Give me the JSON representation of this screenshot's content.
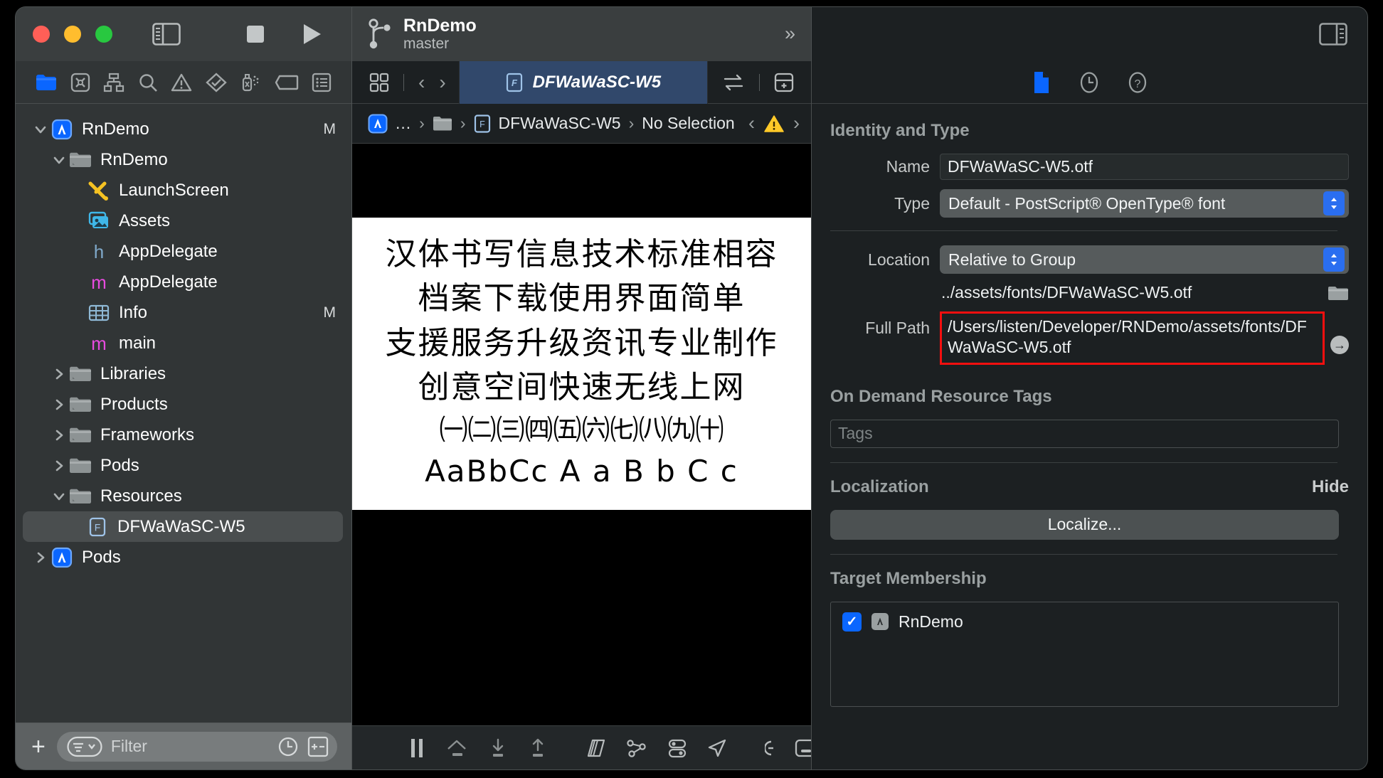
{
  "window": {
    "traffic_lights": [
      "close",
      "minimize",
      "zoom"
    ]
  },
  "toolbar": {
    "sidebar_toggle": "sidebar-toggle-icon",
    "stop_label": "stop-button",
    "run_label": "run-button",
    "scheme_title": "RnDemo",
    "scheme_branch": "master",
    "expand_chevrons": "»",
    "inspector_toggle": "inspector-toggle-icon"
  },
  "navigator": {
    "tabs": [
      "project-navigator-icon",
      "source-control-navigator-icon",
      "hierarchy-navigator-icon",
      "find-navigator-icon",
      "issue-navigator-icon",
      "test-navigator-icon",
      "debug-navigator-icon",
      "breakpoint-navigator-icon",
      "report-navigator-icon"
    ],
    "tree": [
      {
        "label": "RnDemo",
        "icon": "app-project-icon",
        "indent": 0,
        "disclosure": "open",
        "status": "M",
        "selected": false
      },
      {
        "label": "RnDemo",
        "icon": "folder-icon",
        "indent": 1,
        "disclosure": "open",
        "status": "",
        "selected": false
      },
      {
        "label": "LaunchScreen",
        "icon": "storyboard-icon",
        "indent": 2,
        "disclosure": "none",
        "status": "",
        "selected": false
      },
      {
        "label": "Assets",
        "icon": "assets-icon",
        "indent": 2,
        "disclosure": "none",
        "status": "",
        "selected": false
      },
      {
        "label": "AppDelegate",
        "icon": "header-h-icon",
        "indent": 2,
        "disclosure": "none",
        "status": "",
        "selected": false
      },
      {
        "label": "AppDelegate",
        "icon": "objc-m-icon",
        "indent": 2,
        "disclosure": "none",
        "status": "",
        "selected": false
      },
      {
        "label": "Info",
        "icon": "plist-icon",
        "indent": 2,
        "disclosure": "none",
        "status": "M",
        "selected": false
      },
      {
        "label": "main",
        "icon": "objc-m-icon",
        "indent": 2,
        "disclosure": "none",
        "status": "",
        "selected": false
      },
      {
        "label": "Libraries",
        "icon": "folder-icon",
        "indent": 1,
        "disclosure": "closed",
        "status": "",
        "selected": false
      },
      {
        "label": "Products",
        "icon": "folder-icon",
        "indent": 1,
        "disclosure": "closed",
        "status": "",
        "selected": false
      },
      {
        "label": "Frameworks",
        "icon": "folder-icon",
        "indent": 1,
        "disclosure": "closed",
        "status": "",
        "selected": false
      },
      {
        "label": "Pods",
        "icon": "folder-plain-icon",
        "indent": 1,
        "disclosure": "closed",
        "status": "",
        "selected": false
      },
      {
        "label": "Resources",
        "icon": "folder-icon",
        "indent": 1,
        "disclosure": "open",
        "status": "",
        "selected": false
      },
      {
        "label": "DFWaWaSC-W5",
        "icon": "font-file-icon",
        "indent": 2,
        "disclosure": "none",
        "status": "",
        "selected": true
      },
      {
        "label": "Pods",
        "icon": "app-project-icon",
        "indent": 0,
        "disclosure": "closed",
        "status": "",
        "selected": false
      }
    ],
    "filter": {
      "placeholder": "Filter",
      "scope_icon": "filter-scope-icon",
      "recent_icon": "clock-icon",
      "source_control_icon": "sc-filter-icon",
      "add_icon": "+"
    }
  },
  "editor": {
    "jump_bar": {
      "related_items_icon": "related-items-icon",
      "back_icon": "‹",
      "forward_icon": "›",
      "tab_label": "DFWaWaSC-W5",
      "tab_file_icon": "font-file-icon",
      "assistant_icon": "assistant-editor-icon",
      "add_editor_icon": "add-editor-icon"
    },
    "breadcrumb": {
      "project_icon": "app-project-icon",
      "items": [
        "...",
        "folder-icon",
        "DFWaWaSC-W5",
        "No Selection"
      ],
      "file_icon": "font-file-icon",
      "prev_issue_icon": "‹",
      "warning_icon": "warning-icon",
      "next_issue_icon": "›"
    },
    "font_preview": {
      "lines": [
        "汉体书写信息技术标准相容",
        "档案下载使用界面简单",
        "支援服务升级资讯专业制作",
        "创意空间快速无线上网",
        "㈠㈡㈢㈣㈤㈥㈦㈧㈨㈩",
        "AaBbCc A a B b C c"
      ]
    },
    "debug_bar": {
      "icons": [
        "hide-debug-area-icon",
        "pause-icon",
        "step-over-icon",
        "step-into-icon",
        "step-out-icon",
        "view-hierarchy-icon",
        "memory-graph-icon",
        "environment-overrides-icon",
        "simulate-location-icon",
        "console-filter-icon",
        "console-toggle-icon"
      ]
    }
  },
  "inspector": {
    "tabs": [
      "file-inspector-icon",
      "history-inspector-icon",
      "quick-help-icon"
    ],
    "identity": {
      "section_title": "Identity and Type",
      "name_label": "Name",
      "name_value": "DFWaWaSC-W5.otf",
      "type_label": "Type",
      "type_value": "Default - PostScript® OpenType® font",
      "location_label": "Location",
      "location_value": "Relative to Group",
      "relative_path": "../assets/fonts/DFWaWaSC-W5.otf",
      "choose_folder_icon": "folder-icon",
      "full_path_label": "Full Path",
      "full_path_value": "/Users/listen/Developer/RNDemo/assets/fonts/DFWaWaSC-W5.otf",
      "reveal_icon": "→",
      "highlight_color": "#f40f0f"
    },
    "on_demand": {
      "section_title": "On Demand Resource Tags",
      "tags_placeholder": "Tags"
    },
    "localization": {
      "section_title": "Localization",
      "hide_label": "Hide",
      "localize_button": "Localize..."
    },
    "target_membership": {
      "section_title": "Target Membership",
      "targets": [
        {
          "label": "RnDemo",
          "checked": true
        }
      ]
    }
  }
}
